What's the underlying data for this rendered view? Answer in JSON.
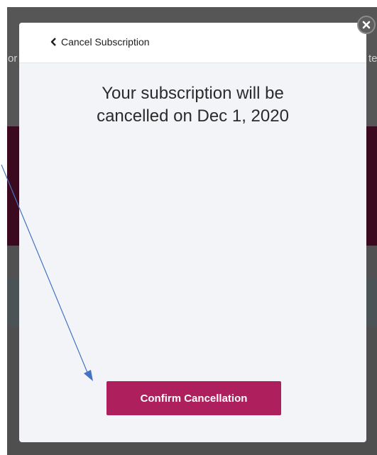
{
  "background": {
    "left_fragment": "or",
    "right_fragment": "te"
  },
  "modal": {
    "back_label": "Cancel Subscription",
    "message_line1": "Your subscription will be",
    "message_line2": "cancelled on Dec 1, 2020",
    "confirm_label": "Confirm Cancellation"
  },
  "icons": {
    "back": "chevron-left-icon",
    "close": "close-icon"
  },
  "colors": {
    "confirm_button": "#ad1f5d",
    "modal_background": "#f3f4f8",
    "annotation_arrow": "#4472c4"
  }
}
